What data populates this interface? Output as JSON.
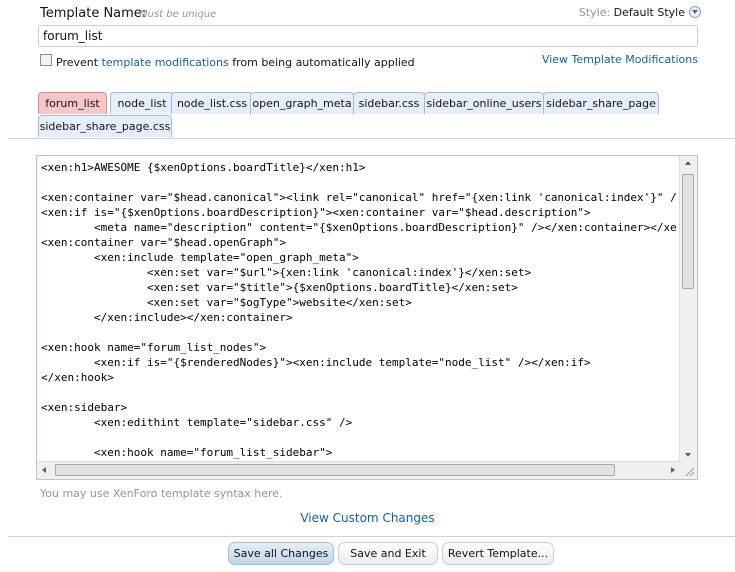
{
  "form": {
    "template_name_label": "Template Name:",
    "template_name_hint": "Must be unique",
    "template_name_value": "forum_list",
    "style_label": "Style:",
    "style_value": "Default Style",
    "prevent_prefix": "Prevent",
    "prevent_link": "template modifications",
    "prevent_suffix": "from being automatically applied",
    "prevent_checked": false,
    "view_modifications": "View Template Modifications"
  },
  "tabs": [
    {
      "label": "forum_list",
      "active": true
    },
    {
      "label": "node_list",
      "active": false
    },
    {
      "label": "node_list.css",
      "active": false
    },
    {
      "label": "open_graph_meta",
      "active": false
    },
    {
      "label": "sidebar.css",
      "active": false
    },
    {
      "label": "sidebar_online_users",
      "active": false
    },
    {
      "label": "sidebar_share_page",
      "active": false
    },
    {
      "label": "sidebar_share_page.css",
      "active": false
    }
  ],
  "editor": {
    "code": "<xen:h1>AWESOME {$xenOptions.boardTitle}</xen:h1>\n\n<xen:container var=\"$head.canonical\"><link rel=\"canonical\" href=\"{xen:link 'canonical:index'}\" /></xen:container>\n<xen:if is=\"{$xenOptions.boardDescription}\"><xen:container var=\"$head.description\">\n\t<meta name=\"description\" content=\"{$xenOptions.boardDescription}\" /></xen:container></xen:if>\n<xen:container var=\"$head.openGraph\">\n\t<xen:include template=\"open_graph_meta\">\n\t\t<xen:set var=\"$url\">{xen:link 'canonical:index'}</xen:set>\n\t\t<xen:set var=\"$title\">{$xenOptions.boardTitle}</xen:set>\n\t\t<xen:set var=\"$ogType\">website</xen:set>\n\t</xen:include></xen:container>\n\n<xen:hook name=\"forum_list_nodes\">\n\t<xen:if is=\"{$renderedNodes}\"><xen:include template=\"node_list\" /></xen:if>\n</xen:hook>\n\n<xen:sidebar>\n\t<xen:edithint template=\"sidebar.css\" />\n\n\t<xen:hook name=\"forum_list_sidebar\">"
  },
  "syntax_hint": "You may use XenForo template syntax here.",
  "view_custom_changes": "View Custom Changes",
  "buttons": {
    "save_all": "Save all Changes",
    "save_exit": "Save and Exit",
    "revert": "Revert Template..."
  }
}
